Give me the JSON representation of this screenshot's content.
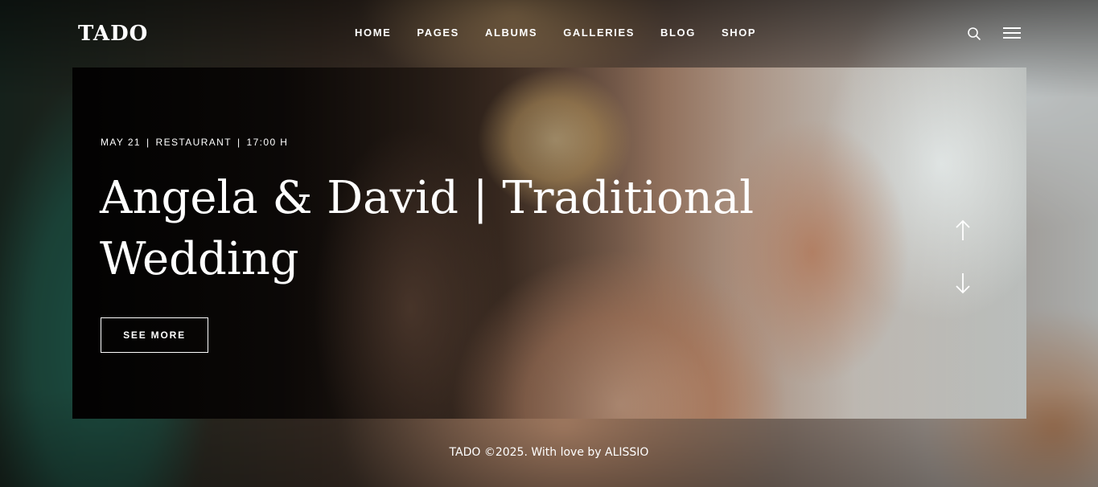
{
  "header": {
    "logo": "TADO",
    "nav": [
      "HOME",
      "PAGES",
      "ALBUMS",
      "GALLERIES",
      "BLOG",
      "SHOP"
    ],
    "search_icon": "search-icon",
    "menu_icon": "hamburger-menu-icon"
  },
  "hero": {
    "date": "MAY 21",
    "separator": "|",
    "location": "RESTAURANT",
    "time": "17:00 H",
    "title": "Angela & David | Traditional Wedding",
    "button_label": "SEE MORE",
    "prev_icon": "arrow-up-icon",
    "next_icon": "arrow-down-icon"
  },
  "footer": {
    "text": "TADO ©2025. With love by ALISSIO"
  },
  "colors": {
    "text": "#ffffff",
    "accent_green": "#1f5a4c"
  }
}
